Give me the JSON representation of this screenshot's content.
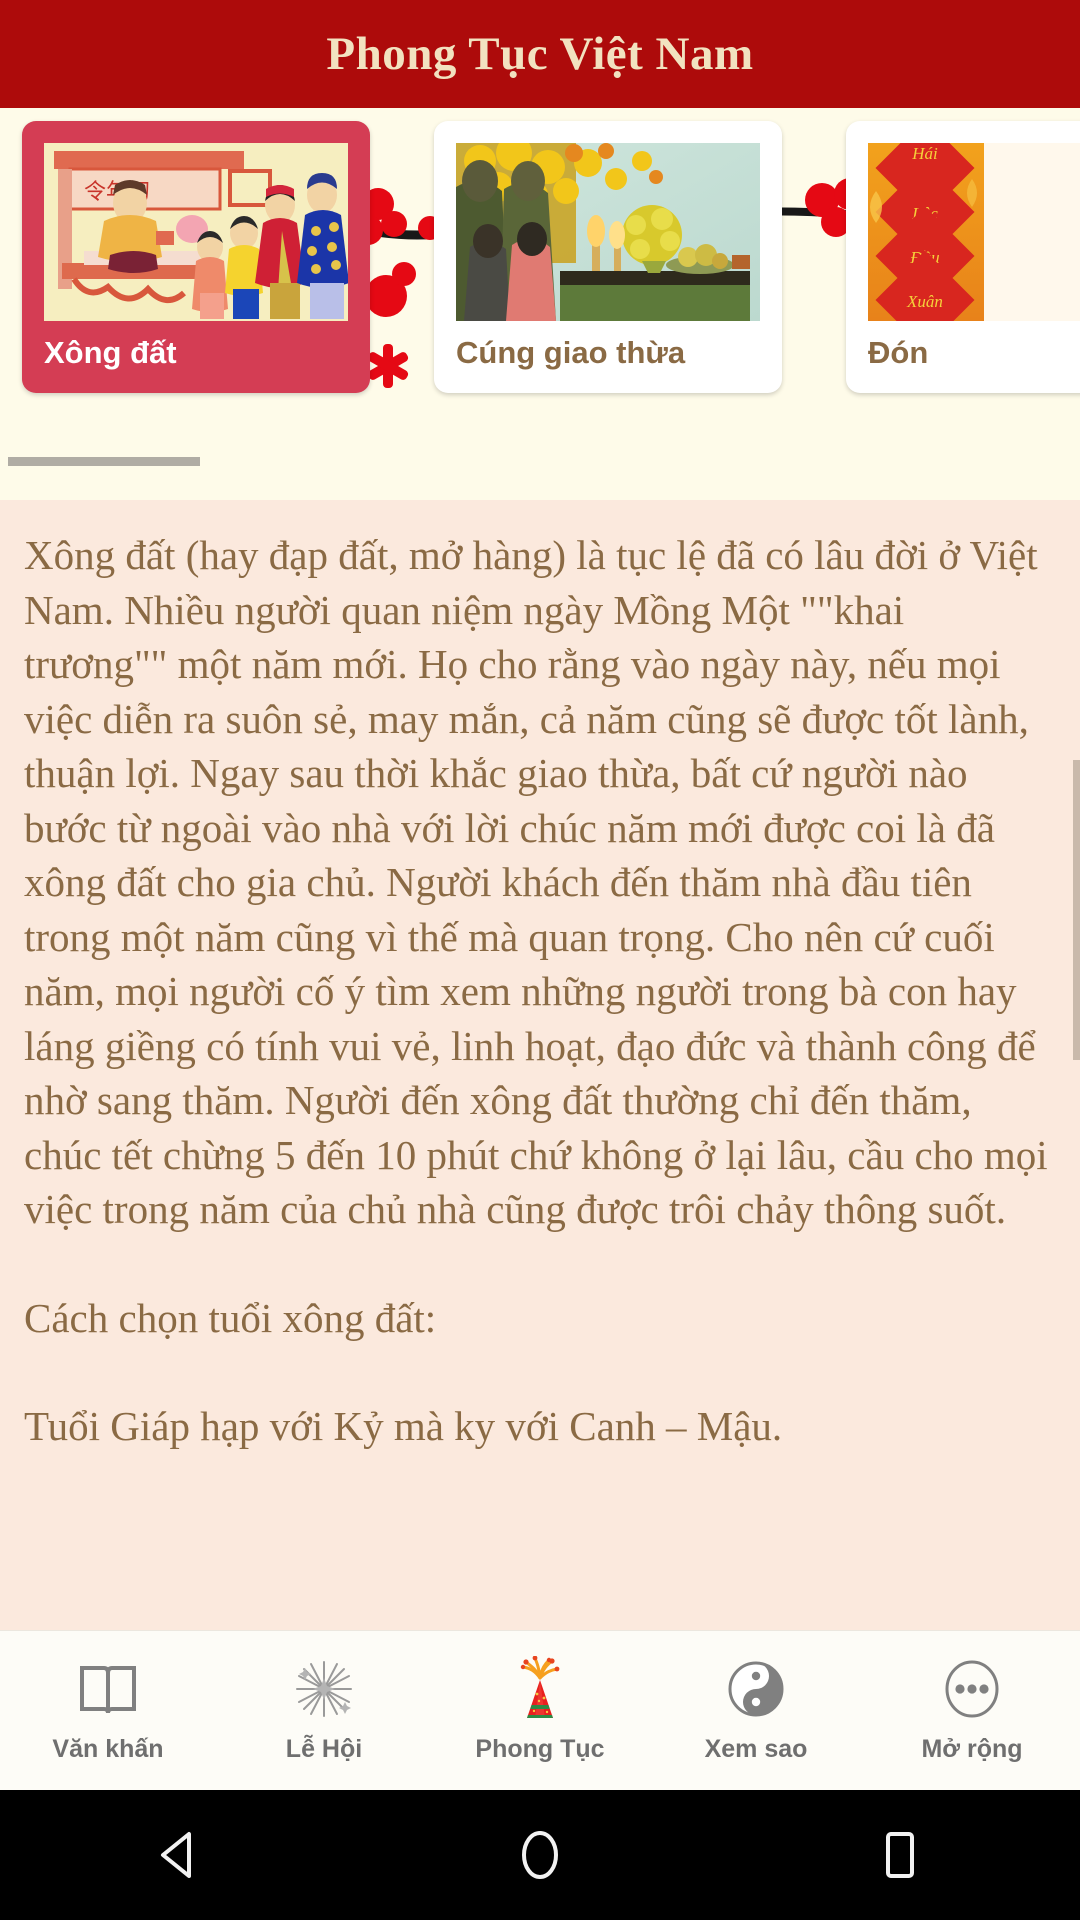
{
  "header": {
    "title": "Phong Tục Việt Nam"
  },
  "carousel": {
    "cards": [
      {
        "label": "Xông đất",
        "selected": true,
        "thumb": "xong-dat-folk-painting"
      },
      {
        "label": "Cúng giao thừa",
        "selected": false,
        "thumb": "cung-giao-thua-altar-photo"
      },
      {
        "label": "Đón",
        "selected": false,
        "thumb": "don-tet-banner-hai-loc-dau-xuan"
      }
    ],
    "scroll_indicator": "horizontal-scrollbar"
  },
  "article": {
    "paragraphs": [
      "Xông đất (hay đạp đất, mở hàng) là tục lệ đã có lâu đời ở Việt Nam. Nhiều người quan niệm ngày Mồng Một \"\"khai trương\"\" một năm mới. Họ cho rằng vào ngày này, nếu mọi việc diễn ra suôn sẻ, may mắn, cả năm cũng sẽ được tốt lành, thuận lợi. Ngay sau thời khắc giao thừa, bất cứ người nào bước từ ngoài vào nhà với lời chúc năm mới được coi là đã xông đất cho gia chủ. Người khách đến thăm nhà đầu tiên trong một năm cũng vì thế mà quan trọng. Cho nên cứ cuối năm, mọi người cố ý tìm xem những người trong bà con hay láng giềng có tính vui vẻ, linh hoạt, đạo đức và thành công để nhờ sang thăm. Người đến xông đất thường chỉ đến thăm, chúc tết chừng 5 đến 10 phút chứ không ở lại lâu, cầu cho mọi việc trong năm của chủ nhà cũng được trôi chảy thông suốt.",
      "Cách chọn tuổi xông đất:",
      "Tuổi Giáp hạp với Kỷ mà ky với Canh – Mậu."
    ]
  },
  "bottom_nav": {
    "items": [
      {
        "label": "Văn khấn",
        "icon": "open-book-icon",
        "active": false
      },
      {
        "label": "Lễ Hội",
        "icon": "sparkle-burst-icon",
        "active": false
      },
      {
        "label": "Phong Tục",
        "icon": "firecracker-cone-icon",
        "active": true
      },
      {
        "label": "Xem sao",
        "icon": "yin-yang-icon",
        "active": false
      },
      {
        "label": "Mở rộng",
        "icon": "more-dots-icon",
        "active": false
      }
    ]
  },
  "system_bar": {
    "buttons": [
      {
        "name": "back-button",
        "icon": "triangle-left-icon"
      },
      {
        "name": "home-button",
        "icon": "circle-icon"
      },
      {
        "name": "recents-button",
        "icon": "square-icon"
      }
    ]
  },
  "colors": {
    "appbar": "#ad0b0b",
    "appbar_text": "#f2e2c0",
    "selected_card": "#d43d54",
    "article_bg": "#fbe9dd",
    "article_text": "#8a6a44",
    "card_label_inactive": "#8a6a44",
    "nav_bg": "#fdfcf7",
    "nav_text": "#6f6f6f"
  }
}
